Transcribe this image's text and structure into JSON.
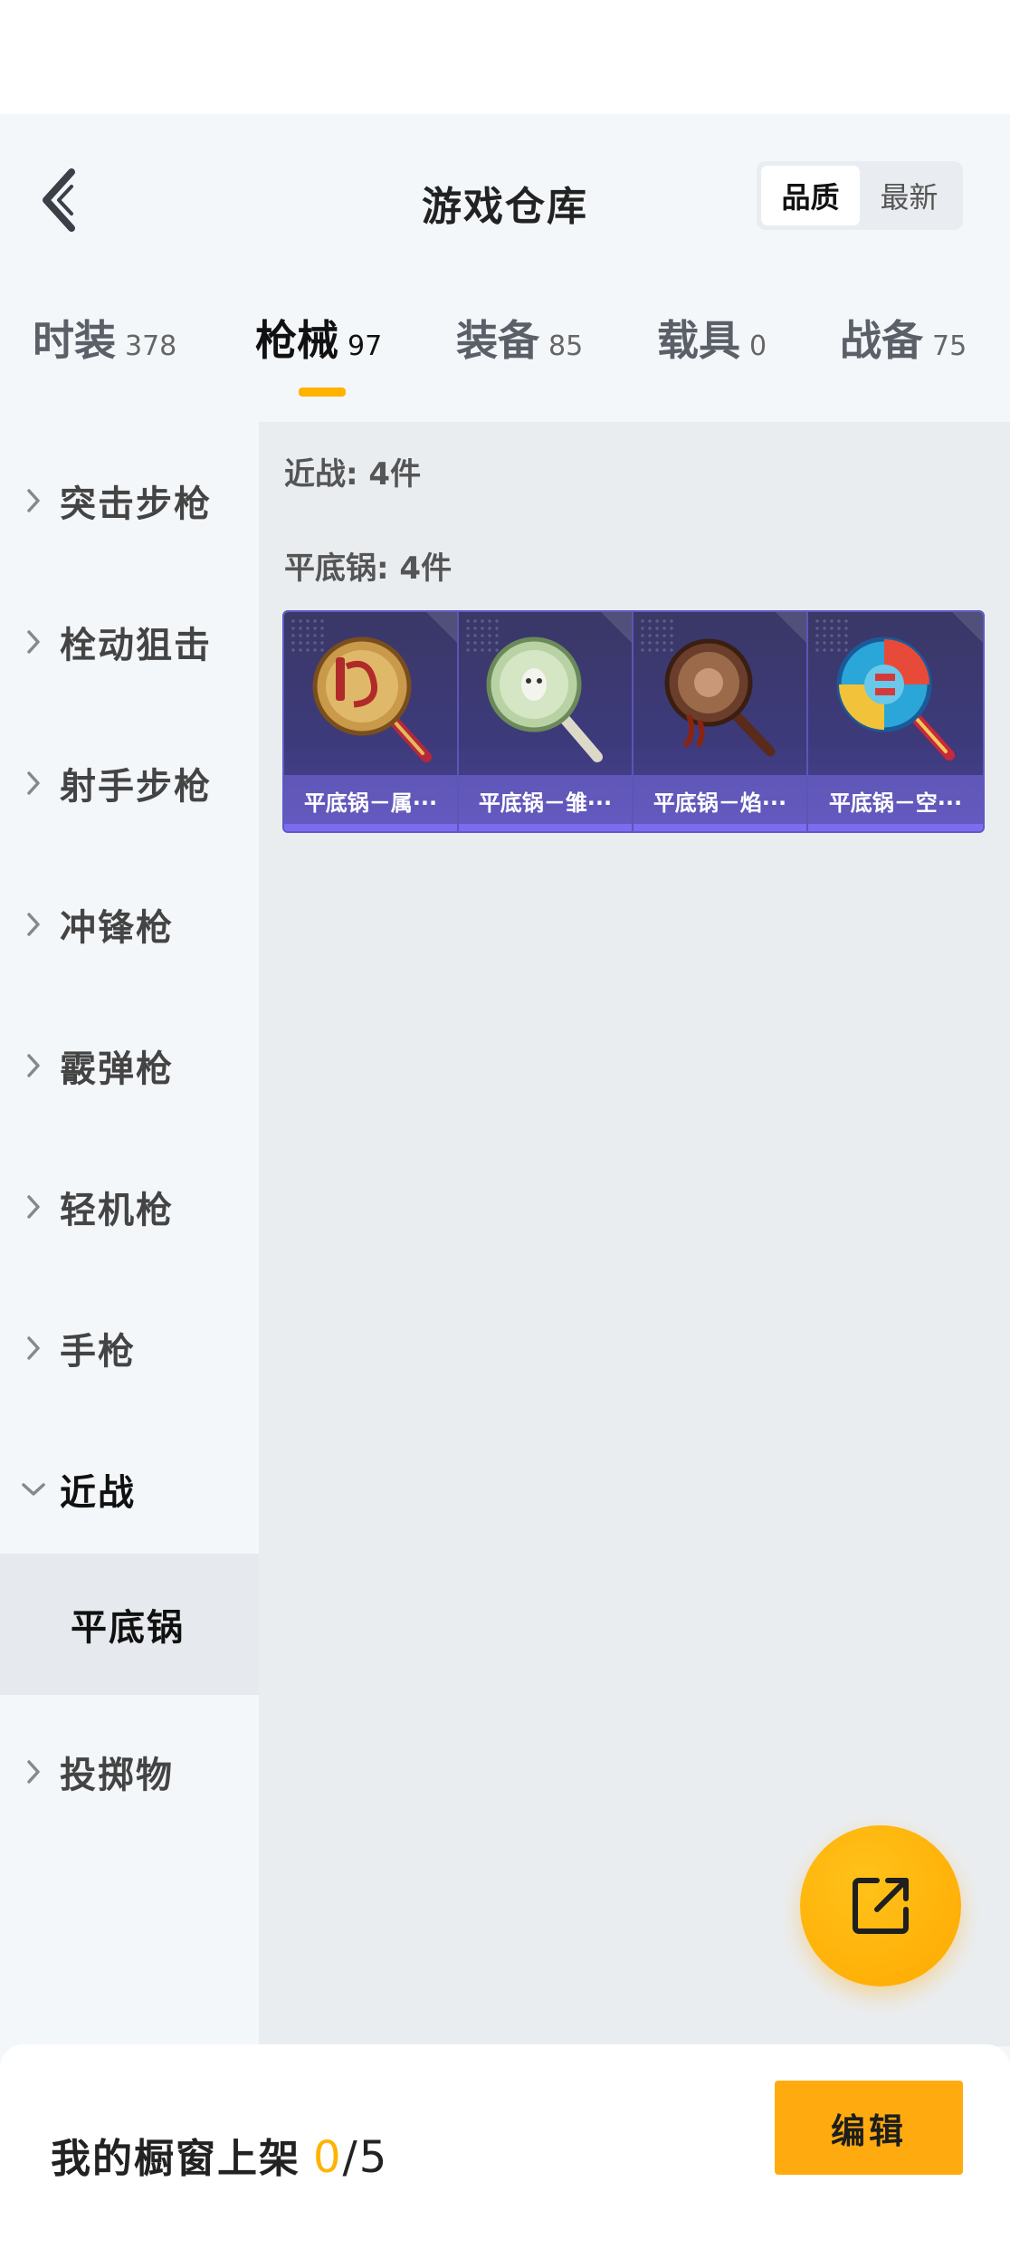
{
  "header": {
    "title": "游戏仓库",
    "sort_options": [
      "品质",
      "最新"
    ],
    "sort_selected": "品质"
  },
  "tabs": [
    {
      "label": "时装",
      "count": "378"
    },
    {
      "label": "枪械",
      "count": "97"
    },
    {
      "label": "装备",
      "count": "85"
    },
    {
      "label": "载具",
      "count": "0"
    },
    {
      "label": "战备",
      "count": "75"
    }
  ],
  "active_tab": "枪械",
  "sidebar": {
    "items": [
      {
        "label": "突击步枪"
      },
      {
        "label": "栓动狙击"
      },
      {
        "label": "射手步枪"
      },
      {
        "label": "冲锋枪"
      },
      {
        "label": "霰弹枪"
      },
      {
        "label": "轻机枪"
      },
      {
        "label": "手枪"
      },
      {
        "label": "近战"
      },
      {
        "label": "投掷物"
      }
    ],
    "expanded": "近战",
    "sub_selected": "平底锅"
  },
  "content": {
    "category_summary": "近战: 4件",
    "subcategory_summary": "平底锅: 4件",
    "items": [
      {
        "name": "平底锅－属···",
        "icon": "pan-gold-icon"
      },
      {
        "name": "平底锅－雏···",
        "icon": "pan-green-icon"
      },
      {
        "name": "平底锅－焰···",
        "icon": "pan-flame-icon"
      },
      {
        "name": "平底锅－空···",
        "icon": "pan-blue-icon"
      }
    ]
  },
  "footer": {
    "shelf_label": "我的橱窗上架",
    "shelf_count": "0",
    "shelf_sep": "/",
    "shelf_total": "5",
    "edit_label": "编辑"
  },
  "colors": {
    "accent": "#ffb200",
    "card_bg": "#3d3a7c",
    "page_bg": "#f4f7fa"
  }
}
